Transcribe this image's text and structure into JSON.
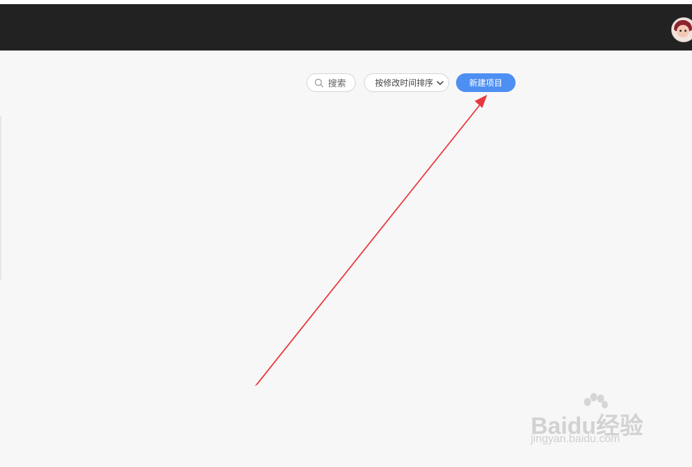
{
  "toolbar": {
    "search_label": "搜索",
    "sort_label": "按修改时间排序",
    "new_project_label": "新建项目"
  },
  "icons": {
    "search": "search-icon",
    "sort": "chevron-down-icon",
    "avatar": "user-avatar"
  },
  "colors": {
    "topbar": "#222222",
    "background": "#f7f7f7",
    "accent": "#4d8ff3",
    "annotation_arrow": "#e8383d"
  },
  "watermark": {
    "brand": "Baidu经验",
    "site": "jingyan.baidu.com"
  }
}
